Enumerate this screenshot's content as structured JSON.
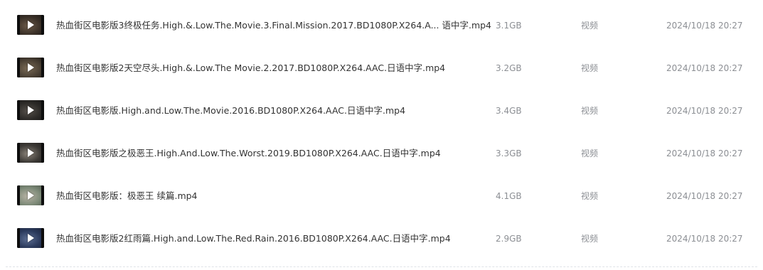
{
  "files": [
    {
      "name": "热血街区电影版3终极任务.High.&.Low.The.Movie.3.Final.Mission.2017.BD1080P.X264.A...  语中字.mp4",
      "size": "3.1GB",
      "type": "视频",
      "date": "2024/10/18 20:27",
      "thumb_icon": "video-thumbnail-play-icon",
      "thumb_colors": [
        "#3b3128",
        "#6b5a48",
        "#1c1814"
      ]
    },
    {
      "name": "热血街区电影版2天空尽头.High.&.Low.The Movie.2.2017.BD1080P.X264.AAC.日语中字.mp4",
      "size": "3.2GB",
      "type": "视频",
      "date": "2024/10/18 20:27",
      "thumb_icon": "video-thumbnail-play-icon",
      "thumb_colors": [
        "#4a4034",
        "#7a6a55",
        "#231e19"
      ]
    },
    {
      "name": "热血街区电影版.High.and.Low.The.Movie.2016.BD1080P.X264.AAC.日语中字.mp4",
      "size": "3.4GB",
      "type": "视频",
      "date": "2024/10/18 20:27",
      "thumb_icon": "video-thumbnail-play-icon",
      "thumb_colors": [
        "#2c2a27",
        "#55504a",
        "#161514"
      ]
    },
    {
      "name": "热血街区电影版之极恶王.High.And.Low.The.Worst.2019.BD1080P.X264.AAC.日语中字.mp4",
      "size": "3.3GB",
      "type": "视频",
      "date": "2024/10/18 20:27",
      "thumb_icon": "video-thumbnail-play-icon",
      "thumb_colors": [
        "#3d3a36",
        "#8a8278",
        "#1e1c1a"
      ]
    },
    {
      "name": "热血街区电影版：极恶王 续篇.mp4",
      "size": "4.1GB",
      "type": "视频",
      "date": "2024/10/18 20:27",
      "thumb_icon": "video-thumbnail-play-icon",
      "thumb_colors": [
        "#7d8a78",
        "#b8b3a5",
        "#4f5a4c"
      ]
    },
    {
      "name": "热血街区电影版2红雨篇.High.and.Low.The.Red.Rain.2016.BD1080P.X264.AAC.日语中字.mp4",
      "size": "2.9GB",
      "type": "视频",
      "date": "2024/10/18 20:27",
      "thumb_icon": "video-thumbnail-play-icon",
      "thumb_colors": [
        "#2b3a5c",
        "#5d6f94",
        "#1a2238"
      ]
    }
  ]
}
